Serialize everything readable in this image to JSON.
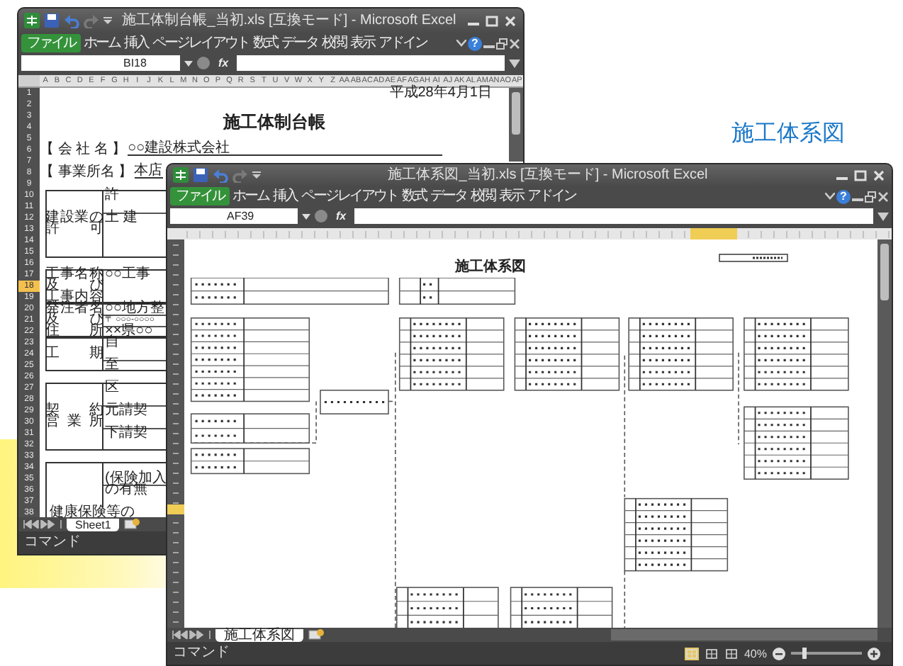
{
  "caption": "施工体系図",
  "windows": [
    {
      "title": "施工体制台帳_当初.xls [互換モード] - Microsoft Excel",
      "ribbon_tabs": [
        {
          "label": "ファイル",
          "selected": true
        },
        {
          "label": "ホーム",
          "selected": false
        },
        {
          "label": "挿入",
          "selected": false
        },
        {
          "label": "ページレイアウト",
          "selected": false
        },
        {
          "label": "数式",
          "selected": false
        },
        {
          "label": "データ",
          "selected": false
        },
        {
          "label": "校閲",
          "selected": false
        },
        {
          "label": "表示",
          "selected": false
        },
        {
          "label": "アドイン",
          "selected": false
        }
      ],
      "help": "?",
      "name_box": "BI18",
      "function_symbol": "fx",
      "sheet": {
        "kind": "ledger",
        "columns": [
          "A",
          "B",
          "C",
          "D",
          "E",
          "F",
          "G",
          "H",
          "I",
          "J",
          "K",
          "L",
          "M",
          "N",
          "O",
          "P",
          "Q",
          "R",
          "S",
          "T",
          "U",
          "V",
          "W",
          "X",
          "Y",
          "Z",
          "AA",
          "AB",
          "AC",
          "AD",
          "AE",
          "AF",
          "AG",
          "AH",
          "AI",
          "AJ",
          "AK",
          "AL",
          "AM",
          "AN",
          "AO",
          "AP"
        ],
        "rows": [
          {
            "label": "1",
            "selected": false
          },
          {
            "label": "2",
            "selected": false
          },
          {
            "label": "3",
            "selected": false
          },
          {
            "label": "4",
            "selected": false
          },
          {
            "label": "5",
            "selected": false
          },
          {
            "label": "6",
            "selected": false
          },
          {
            "label": "7",
            "selected": false
          },
          {
            "label": "8",
            "selected": false
          },
          {
            "label": "9",
            "selected": false
          },
          {
            "label": "10",
            "selected": false
          },
          {
            "label": "11",
            "selected": false
          },
          {
            "label": "12",
            "selected": false
          },
          {
            "label": "13",
            "selected": false
          },
          {
            "label": "14",
            "selected": false
          },
          {
            "label": "15",
            "selected": false
          },
          {
            "label": "16",
            "selected": false
          },
          {
            "label": "17",
            "selected": false
          },
          {
            "label": "18",
            "selected": true
          },
          {
            "label": "19",
            "selected": false
          },
          {
            "label": "20",
            "selected": false
          },
          {
            "label": "21",
            "selected": false
          },
          {
            "label": "22",
            "selected": false
          },
          {
            "label": "23",
            "selected": false
          },
          {
            "label": "24",
            "selected": false
          },
          {
            "label": "25",
            "selected": false
          },
          {
            "label": "26",
            "selected": false
          },
          {
            "label": "27",
            "selected": false
          },
          {
            "label": "28",
            "selected": false
          },
          {
            "label": "29",
            "selected": false
          },
          {
            "label": "30",
            "selected": false
          },
          {
            "label": "31",
            "selected": false
          },
          {
            "label": "32",
            "selected": false
          },
          {
            "label": "33",
            "selected": false
          },
          {
            "label": "34",
            "selected": false
          },
          {
            "label": "35",
            "selected": false
          },
          {
            "label": "36",
            "selected": false
          },
          {
            "label": "37",
            "selected": false
          },
          {
            "label": "38",
            "selected": false
          }
        ],
        "date": "平成28年4月1日",
        "heading": "施工体制台帳",
        "company_label": "【 会 社 名 】",
        "company": "○○建設株式会社",
        "office_label": "【 事業所名 】",
        "office": "本店",
        "blocks": [
          {
            "label_lines": [
              "建設業の",
              "許可"
            ],
            "entries": [
              "許",
              "土 建"
            ]
          },
          {
            "label_lines": [
              "工事名称",
              "及び",
              "工事内容"
            ],
            "entries": [
              "○○工事"
            ]
          },
          {
            "label_lines": [
              "発注者名",
              "及び",
              "住所"
            ],
            "entries": [
              "○○地方整",
              "〒 ○○○-○○○○",
              "××県○○"
            ]
          },
          {
            "label_lines": [
              "工期"
            ],
            "entries": [
              "自",
              "至"
            ]
          },
          {
            "label_lines": [
              "契約",
              "営業所"
            ],
            "entries": [
              "区",
              "元請契",
              "下請契"
            ]
          },
          {
            "label_lines": [
              "健康保険等の"
            ],
            "entries": [
              "(保険加入",
              "の有無"
            ]
          }
        ]
      },
      "sheet_tabs": [
        {
          "label": "Sheet1",
          "selected": true
        }
      ],
      "status": "コマンド"
    },
    {
      "title": "施工体系図_当初.xls [互換モード] - Microsoft Excel",
      "ribbon_tabs": [
        {
          "label": "ファイル",
          "selected": true
        },
        {
          "label": "ホーム",
          "selected": false
        },
        {
          "label": "挿入",
          "selected": false
        },
        {
          "label": "ページレイアウト",
          "selected": false
        },
        {
          "label": "数式",
          "selected": false
        },
        {
          "label": "データ",
          "selected": false
        },
        {
          "label": "校閲",
          "selected": false
        },
        {
          "label": "表示",
          "selected": false
        },
        {
          "label": "アドイン",
          "selected": false
        }
      ],
      "help": "?",
      "name_box": "AF39",
      "function_symbol": "fx",
      "sheet": {
        "kind": "diagram",
        "heading": "施工体系図"
      },
      "sheet_tabs": [
        {
          "label": "施工体系図",
          "selected": true
        }
      ],
      "status": "コマンド",
      "view_buttons": [
        {
          "selected": true
        },
        {
          "selected": false
        },
        {
          "selected": false
        }
      ],
      "zoom": "40%",
      "zoom_slider": {
        "level": 0.17
      }
    }
  ]
}
